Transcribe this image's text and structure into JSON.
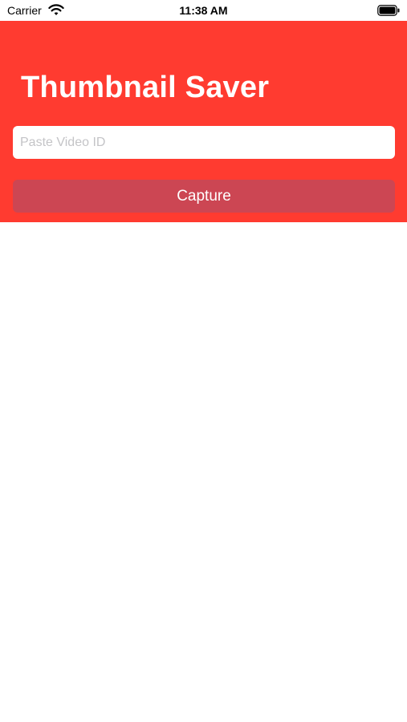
{
  "status_bar": {
    "carrier": "Carrier",
    "time": "11:38 AM",
    "wifi_icon": "wifi-icon",
    "battery_icon": "battery-icon"
  },
  "header": {
    "title": "Thumbnail Saver"
  },
  "form": {
    "video_id_value": "",
    "video_id_placeholder": "Paste Video ID",
    "capture_label": "Capture"
  },
  "colors": {
    "accent": "#ff3b30",
    "button": "#cc4653",
    "input_background": "#ffffff"
  }
}
